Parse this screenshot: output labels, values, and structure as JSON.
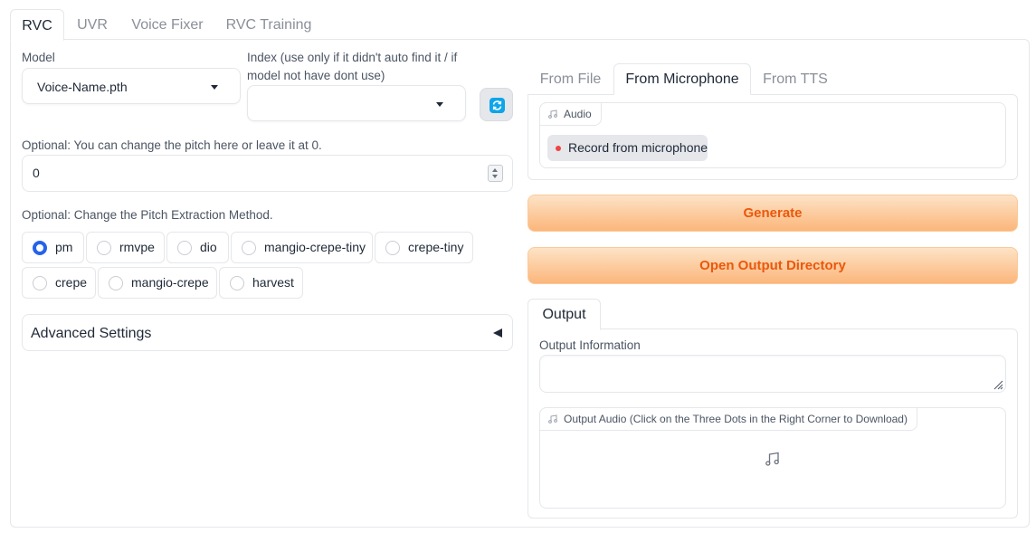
{
  "tabs": [
    "RVC",
    "UVR",
    "Voice Fixer",
    "RVC Training"
  ],
  "model": {
    "label": "Model",
    "value": "Voice-Name.pth"
  },
  "index": {
    "label_line1": "Index (use only if it didn't auto find it / if",
    "label_line2": "model not have dont use)",
    "value": ""
  },
  "pitch": {
    "label": "Optional: You can change the pitch here or leave it at 0.",
    "value": "0"
  },
  "method": {
    "label": "Optional: Change the Pitch Extraction Method.",
    "options": [
      "pm",
      "rmvpe",
      "dio",
      "mangio-crepe-tiny",
      "crepe-tiny",
      "crepe",
      "mangio-crepe",
      "harvest"
    ],
    "selected": "pm"
  },
  "advanced": {
    "label": "Advanced Settings"
  },
  "source_tabs": [
    "From File",
    "From Microphone",
    "From TTS"
  ],
  "audio_input": {
    "label": "Audio",
    "record_label": "Record from microphone"
  },
  "buttons": {
    "generate": "Generate",
    "open_dir": "Open Output Directory"
  },
  "output": {
    "tab": "Output",
    "info_label": "Output Information",
    "info_value": "",
    "audio_label": "Output Audio (Click on the Three Dots in the Right Corner to Download)"
  },
  "colors": {
    "accent": "#ea580c",
    "radio": "#2563eb",
    "record": "#ef4444",
    "refresh": "#0ea5e9"
  }
}
